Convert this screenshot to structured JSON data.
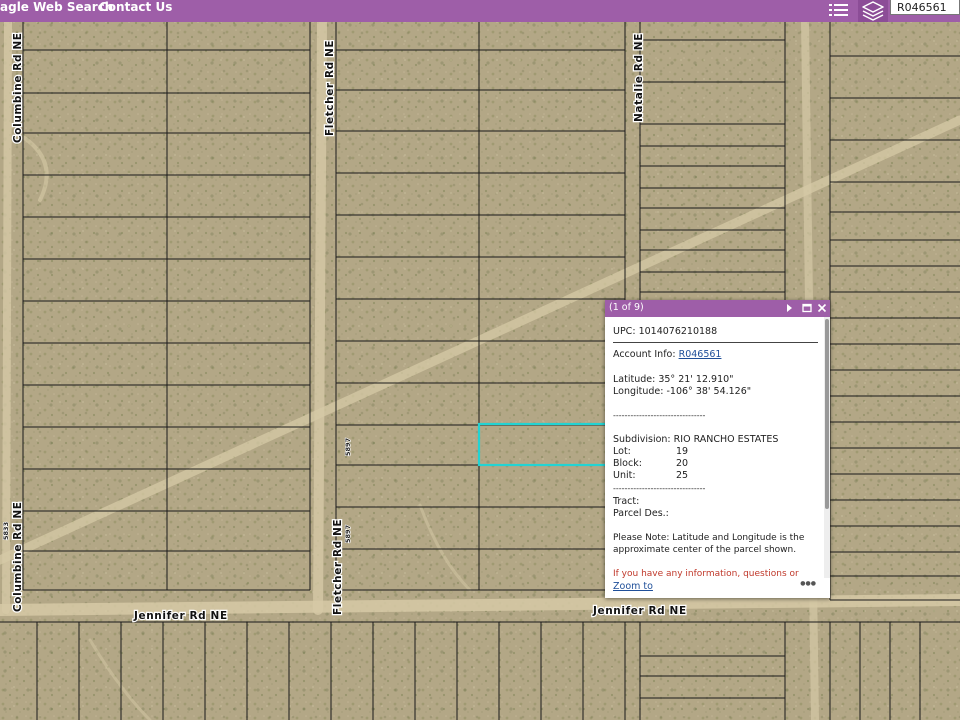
{
  "nav": {
    "items": [
      {
        "label": "agle Web Search"
      },
      {
        "label": "Contact Us"
      }
    ],
    "list_icon": "list-icon",
    "layers_icon": "layers-icon"
  },
  "search": {
    "value": "R046561"
  },
  "map": {
    "highlight_color": "#22d3d3",
    "roads": {
      "columbine_north": "Columbine Rd NE",
      "columbine_south": "Columbine Rd NE",
      "fletcher_north": "Fletcher Rd NE",
      "fletcher_south": "Fletcher Rd NE",
      "natalie": "Natalie Rd NE",
      "jennifer_west": "Jennifer Rd NE",
      "jennifer_east": "Jennifer Rd NE"
    },
    "address_numbers": {
      "a": "5897",
      "b": "5897",
      "c": "5833"
    }
  },
  "popup": {
    "page": "(1 of 9)",
    "upc_label": "UPC:",
    "upc": "1014076210188",
    "account_label": "Account Info:",
    "account": "R046561",
    "latitude_label": "Latitude:",
    "latitude": "35° 21' 12.910\"",
    "longitude_label": "Longitude:",
    "longitude": "-106° 38' 54.126\"",
    "separator": "--------------------------------",
    "subdivision_label": "Subdivision:",
    "subdivision": "RIO RANCHO ESTATES",
    "lot_label": "Lot:",
    "lot": "19",
    "block_label": "Block:",
    "block": "20",
    "unit_label": "Unit:",
    "unit": "25",
    "separator2": "--------------------------------",
    "tract_label": "Tract:",
    "parcel_label": "Parcel Des.:",
    "note_1": "Please Note: Latitude and Longitude is the",
    "note_2": "approximate center of the parcel shown.",
    "info_text": "If you have any information, questions or",
    "zoom_link": "Zoom to",
    "info_color": "#c0392b"
  }
}
